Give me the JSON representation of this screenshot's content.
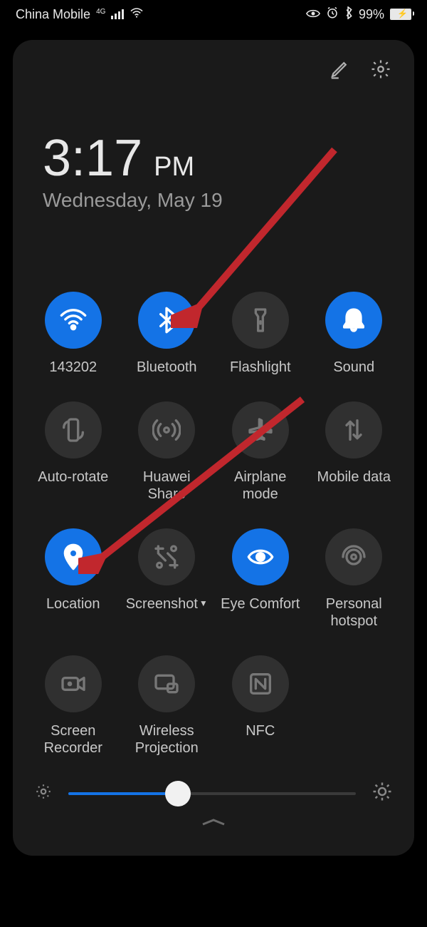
{
  "status": {
    "carrier": "China Mobile",
    "network_badge": "4G",
    "battery_pct": "99%"
  },
  "panel": {
    "time": "3:17",
    "ampm": "PM",
    "date": "Wednesday, May 19"
  },
  "tiles": {
    "wifi": {
      "label": "143202",
      "on": true
    },
    "bluetooth": {
      "label": "Bluetooth",
      "on": true
    },
    "flashlight": {
      "label": "Flashlight",
      "on": false
    },
    "sound": {
      "label": "Sound",
      "on": true
    },
    "autorotate": {
      "label": "Auto-rotate",
      "on": false
    },
    "huaweishare": {
      "label": "Huawei Share",
      "on": false
    },
    "airplane": {
      "label": "Airplane mode",
      "on": false
    },
    "mobiledata": {
      "label": "Mobile data",
      "on": false
    },
    "location": {
      "label": "Location",
      "on": true
    },
    "screenshot": {
      "label": "Screenshot",
      "on": false,
      "has_caret": true
    },
    "eyecomfort": {
      "label": "Eye Comfort",
      "on": true
    },
    "hotspot": {
      "label": "Personal hotspot",
      "on": false
    },
    "recorder": {
      "label": "Screen Recorder",
      "on": false
    },
    "projection": {
      "label": "Wireless Projection",
      "on": false
    },
    "nfc": {
      "label": "NFC",
      "on": false
    }
  },
  "brightness": {
    "value_pct": 38
  },
  "colors": {
    "accent": "#1473e6",
    "annotation": "#c1272d"
  }
}
